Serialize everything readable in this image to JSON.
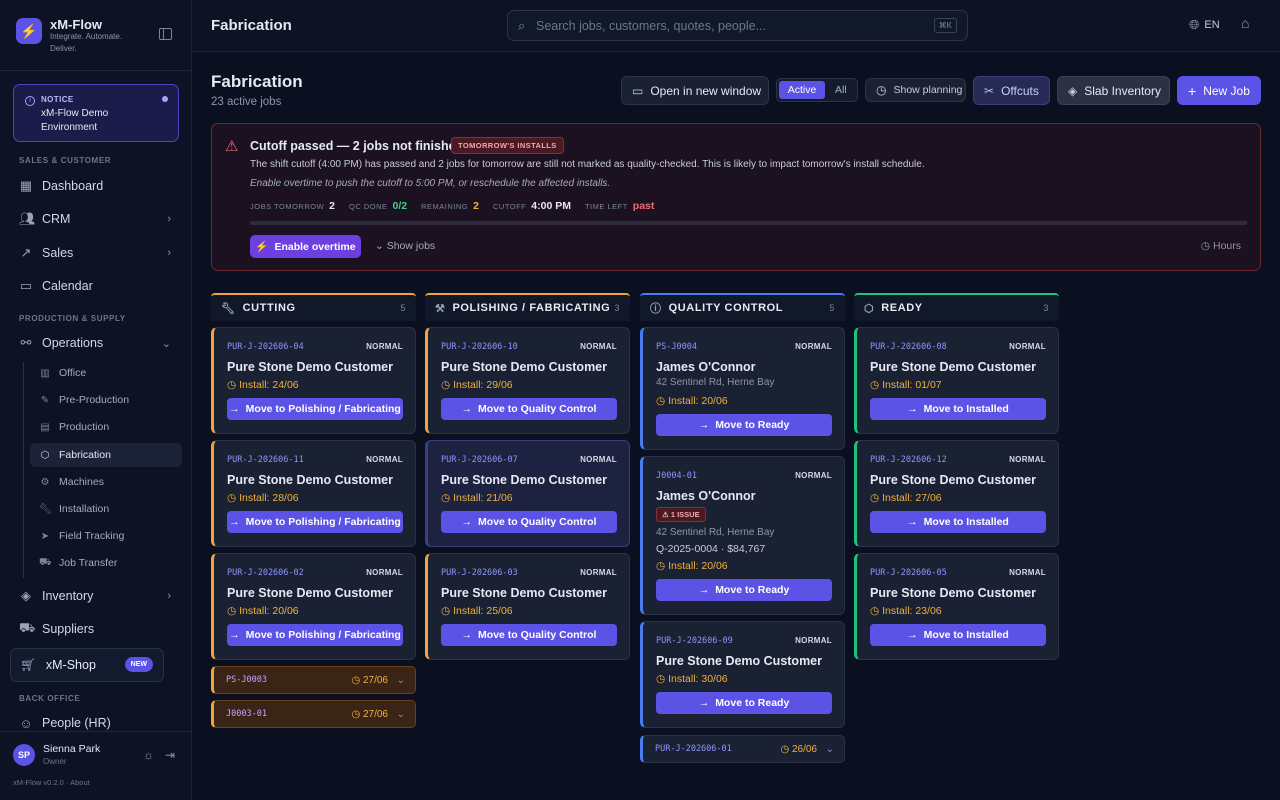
{
  "sidebar": {
    "app_name": "xM-Flow",
    "tagline": "Integrate. Automate. Deliver.",
    "notice": {
      "label": "NOTICE",
      "text": "xM-Flow Demo Environment"
    },
    "sections": {
      "sales": "SALES & CUSTOMER",
      "production": "PRODUCTION & SUPPLY",
      "back_office": "BACK OFFICE"
    },
    "nav": {
      "dashboard": "Dashboard",
      "crm": "CRM",
      "sales": "Sales",
      "calendar": "Calendar",
      "operations": "Operations",
      "inventory": "Inventory",
      "suppliers": "Suppliers",
      "shop": "xM-Shop",
      "shop_badge": "NEW",
      "people": "People (HR)"
    },
    "operations_items": [
      "Office",
      "Pre-Production",
      "Production",
      "Fabrication",
      "Machines",
      "Installation",
      "Field Tracking",
      "Job Transfer"
    ],
    "active_item": "Fabrication",
    "user": {
      "initials": "SP",
      "name": "Sienna Park",
      "role": "Owner"
    },
    "version": "xM-Flow v0.2.0 · About"
  },
  "topbar": {
    "title": "Fabrication",
    "search_placeholder": "Search jobs, customers, quotes, people...",
    "shortcut": "⌘K",
    "lang": "EN"
  },
  "page": {
    "title": "Fabrication",
    "subtitle": "23 active jobs",
    "buttons": {
      "open_window": "Open in new window",
      "active": "Active",
      "all": "All",
      "show_planning": "Show planning",
      "offcuts": "Offcuts",
      "slab_inventory": "Slab Inventory",
      "new_job": "New Job"
    }
  },
  "alert": {
    "title": "Cutoff passed — 2 jobs not finished",
    "badge": "TOMORROW'S INSTALLS",
    "text": "The shift cutoff (4:00 PM) has passed and 2 jobs for tomorrow are still not marked as quality-checked. This is likely to impact tomorrow's install schedule.",
    "hint": "Enable overtime to push the cutoff to 5:00 PM, or reschedule the affected installs.",
    "stats": {
      "jobs_label": "JOBS TOMORROW",
      "jobs": "2",
      "qc_label": "QC DONE",
      "qc": "0/2",
      "remaining_label": "REMAINING",
      "remaining": "2",
      "cutoff_label": "CUTOFF",
      "cutoff": "4:00 PM",
      "time_label": "TIME LEFT",
      "time": "past"
    },
    "enable_btn": "Enable overtime",
    "show_jobs": "Show jobs",
    "hours": "Hours",
    "accent": "#f06a75"
  },
  "columns": [
    {
      "title": "CUTTING",
      "count": "5",
      "color": "#f2a33a",
      "icon": "wrench-icon"
    },
    {
      "title": "POLISHING / FABRICATING",
      "count": "3",
      "color": "#f2a33a",
      "icon": "hammer-icon"
    },
    {
      "title": "QUALITY CONTROL",
      "count": "5",
      "color": "#4a7cf0",
      "icon": "info-circle-icon"
    },
    {
      "title": "READY",
      "count": "3",
      "color": "#22c07a",
      "icon": "box-icon"
    }
  ],
  "cards": {
    "cutting": [
      {
        "id": "PUR-J-202606-04",
        "priority": "NORMAL",
        "customer": "Pure Stone Demo Customer",
        "install": "Install: 24/06",
        "action": "Move to Polishing / Fabricating"
      },
      {
        "id": "PUR-J-202606-11",
        "priority": "NORMAL",
        "customer": "Pure Stone Demo Customer",
        "install": "Install: 28/06",
        "action": "Move to Polishing / Fabricating"
      },
      {
        "id": "PUR-J-202606-02",
        "priority": "NORMAL",
        "customer": "Pure Stone Demo Customer",
        "install": "Install: 20/06",
        "action": "Move to Polishing / Fabricating"
      }
    ],
    "cutting_collapsed": [
      {
        "id": "PS-J0003",
        "date": "27/06"
      },
      {
        "id": "J0003-01",
        "date": "27/06"
      }
    ],
    "polishing": [
      {
        "id": "PUR-J-202606-10",
        "priority": "NORMAL",
        "customer": "Pure Stone Demo Customer",
        "install": "Install: 29/06",
        "action": "Move to Quality Control"
      },
      {
        "id": "PUR-J-202606-07",
        "priority": "NORMAL",
        "customer": "Pure Stone Demo Customer",
        "install": "Install: 21/06",
        "action": "Move to Quality Control"
      },
      {
        "id": "PUR-J-202606-03",
        "priority": "NORMAL",
        "customer": "Pure Stone Demo Customer",
        "install": "Install: 25/06",
        "action": "Move to Quality Control"
      }
    ],
    "qc": [
      {
        "id": "PS-J0004",
        "priority": "NORMAL",
        "customer": "James O'Connor",
        "address": "42 Sentinel Rd, Herne Bay",
        "install": "Install: 20/06",
        "action": "Move to Ready"
      },
      {
        "id": "J0004-01",
        "priority": "NORMAL",
        "customer": "James O'Connor",
        "issue": "1 ISSUE",
        "address": "42 Sentinel Rd, Herne Bay",
        "quote": "Q-2025-0004 · $84,767",
        "install": "Install: 20/06",
        "action": "Move to Ready"
      },
      {
        "id": "PUR-J-202606-09",
        "priority": "NORMAL",
        "customer": "Pure Stone Demo Customer",
        "install": "Install: 30/06",
        "action": "Move to Ready"
      }
    ],
    "qc_collapsed": [
      {
        "id": "PUR-J-202606-01",
        "date": "26/06"
      }
    ],
    "ready": [
      {
        "id": "PUR-J-202606-08",
        "priority": "NORMAL",
        "customer": "Pure Stone Demo Customer",
        "install": "Install: 01/07",
        "action": "Move to Installed"
      },
      {
        "id": "PUR-J-202606-12",
        "priority": "NORMAL",
        "customer": "Pure Stone Demo Customer",
        "install": "Install: 27/06",
        "action": "Move to Installed"
      },
      {
        "id": "PUR-J-202606-05",
        "priority": "NORMAL",
        "customer": "Pure Stone Demo Customer",
        "install": "Install: 23/06",
        "action": "Move to Installed"
      }
    ]
  }
}
